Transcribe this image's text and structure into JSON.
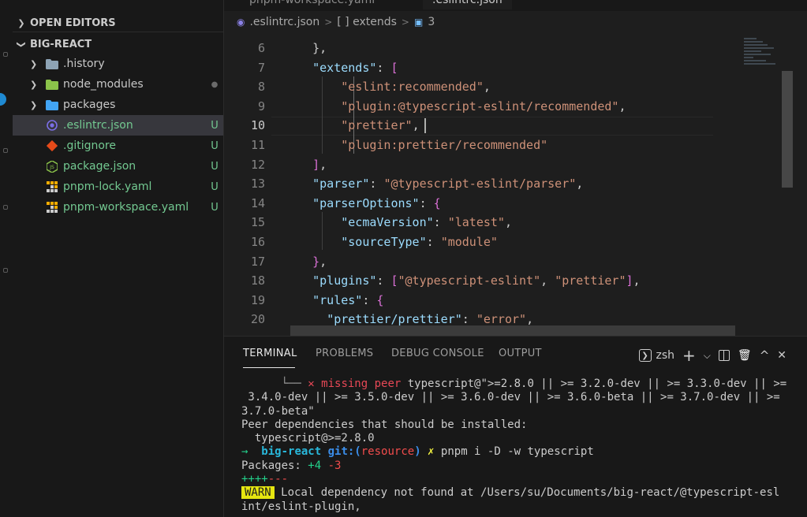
{
  "explorer": {
    "open_editors_label": "OPEN EDITORS",
    "project_label": "BIG-REACT",
    "items": [
      {
        "name": ".history",
        "kind": "folder",
        "icon": "folder-icon",
        "color": "#8da3b5"
      },
      {
        "name": "node_modules",
        "kind": "folder",
        "icon": "node-folder-icon",
        "color": "#8bc34a",
        "dot": "●"
      },
      {
        "name": "packages",
        "kind": "folder",
        "icon": "packages-folder-icon",
        "color": "#42a5f5"
      },
      {
        "name": ".eslintrc.json",
        "kind": "file",
        "icon": "eslint-icon",
        "color": "#7b6fe6",
        "status": "U",
        "selected": true
      },
      {
        "name": ".gitignore",
        "kind": "file",
        "icon": "git-icon",
        "color": "#e64a19",
        "status": "U"
      },
      {
        "name": "package.json",
        "kind": "file",
        "icon": "nodejs-icon",
        "color": "#8bc34a",
        "status": "U"
      },
      {
        "name": "pnpm-lock.yaml",
        "kind": "file",
        "icon": "pnpm-icon",
        "color": "#f9a825",
        "status": "U"
      },
      {
        "name": "pnpm-workspace.yaml",
        "kind": "file",
        "icon": "pnpm-icon",
        "color": "#f9a825",
        "status": "U"
      }
    ]
  },
  "tabs": [
    "pnpm-workspace.yaml",
    ".eslintrc.json"
  ],
  "breadcrumb": {
    "file": ".eslintrc.json",
    "sep": ">",
    "node": "[ ] extends",
    "count": "3"
  },
  "editor": {
    "current_line": 10,
    "lines": [
      {
        "n": "6",
        "tokens": [
          [
            "pn",
            "    },"
          ]
        ]
      },
      {
        "n": "7",
        "tokens": [
          [
            "pn",
            "    "
          ],
          [
            "k",
            "\"extends\""
          ],
          [
            "pn",
            ": "
          ],
          [
            "p",
            "["
          ]
        ]
      },
      {
        "n": "8",
        "tokens": [
          [
            "pn",
            "        "
          ],
          [
            "s",
            "\"eslint:recommended\""
          ],
          [
            "pn",
            ","
          ]
        ]
      },
      {
        "n": "9",
        "tokens": [
          [
            "pn",
            "        "
          ],
          [
            "s",
            "\"plugin:@typescript-eslint/recommended\""
          ],
          [
            "pn",
            ","
          ]
        ]
      },
      {
        "n": "10",
        "tokens": [
          [
            "pn",
            "        "
          ],
          [
            "s",
            "\"prettier\""
          ],
          [
            "pn",
            ","
          ]
        ]
      },
      {
        "n": "11",
        "tokens": [
          [
            "pn",
            "        "
          ],
          [
            "s",
            "\"plugin:prettier/recommended\""
          ]
        ]
      },
      {
        "n": "12",
        "tokens": [
          [
            "pn",
            "    "
          ],
          [
            "p",
            "]"
          ],
          [
            "pn",
            ","
          ]
        ]
      },
      {
        "n": "13",
        "tokens": [
          [
            "pn",
            "    "
          ],
          [
            "k",
            "\"parser\""
          ],
          [
            "pn",
            ": "
          ],
          [
            "s",
            "\"@typescript-eslint/parser\""
          ],
          [
            "pn",
            ","
          ]
        ]
      },
      {
        "n": "14",
        "tokens": [
          [
            "pn",
            "    "
          ],
          [
            "k",
            "\"parserOptions\""
          ],
          [
            "pn",
            ": "
          ],
          [
            "p",
            "{"
          ]
        ]
      },
      {
        "n": "15",
        "tokens": [
          [
            "pn",
            "        "
          ],
          [
            "k",
            "\"ecmaVersion\""
          ],
          [
            "pn",
            ": "
          ],
          [
            "s",
            "\"latest\""
          ],
          [
            "pn",
            ","
          ]
        ]
      },
      {
        "n": "16",
        "tokens": [
          [
            "pn",
            "        "
          ],
          [
            "k",
            "\"sourceType\""
          ],
          [
            "pn",
            ": "
          ],
          [
            "s",
            "\"module\""
          ]
        ]
      },
      {
        "n": "17",
        "tokens": [
          [
            "pn",
            "    "
          ],
          [
            "p",
            "}"
          ],
          [
            "pn",
            ","
          ]
        ]
      },
      {
        "n": "18",
        "tokens": [
          [
            "pn",
            "    "
          ],
          [
            "k",
            "\"plugins\""
          ],
          [
            "pn",
            ": "
          ],
          [
            "p",
            "["
          ],
          [
            "s",
            "\"@typescript-eslint\""
          ],
          [
            "pn",
            ", "
          ],
          [
            "s",
            "\"prettier\""
          ],
          [
            "p",
            "]"
          ],
          [
            "pn",
            ","
          ]
        ]
      },
      {
        "n": "19",
        "tokens": [
          [
            "pn",
            "    "
          ],
          [
            "k",
            "\"rules\""
          ],
          [
            "pn",
            ": "
          ],
          [
            "p",
            "{"
          ]
        ]
      },
      {
        "n": "20",
        "tokens": [
          [
            "pn",
            "      "
          ],
          [
            "k",
            "\"prettier/prettier\""
          ],
          [
            "pn",
            ": "
          ],
          [
            "s",
            "\"error\""
          ],
          [
            "pn",
            ","
          ]
        ]
      }
    ]
  },
  "panel": {
    "tabs": [
      "TERMINAL",
      "PROBLEMS",
      "DEBUG CONSOLE",
      "OUTPUT"
    ],
    "active_tab": "TERMINAL",
    "shell": "zsh",
    "actions": {
      "add": "+",
      "dropdown": "⌵",
      "trash": "🗑",
      "maximize": "^",
      "close": "✕"
    }
  },
  "terminal": {
    "lines": [
      [
        [
          "dim",
          "      └── "
        ],
        [
          "red",
          "✕ missing peer "
        ],
        [
          "pn",
          "typescript@\">=2.8.0 || >= 3.2.0-dev || >= 3.3.0-dev || >="
        ]
      ],
      [
        [
          "pn",
          " 3.4.0-dev || >= 3.5.0-dev || >= 3.6.0-dev || >= 3.6.0-beta || >= 3.7.0-dev || >="
        ]
      ],
      [
        [
          "pn",
          "3.7.0-beta\""
        ]
      ],
      [
        [
          "pn",
          "Peer dependencies that should be installed:"
        ]
      ],
      [
        [
          "pn",
          "  typescript@>=2.8.0"
        ]
      ],
      [
        [
          "green",
          "→  "
        ],
        [
          "cyan",
          "big-react "
        ],
        [
          "blue",
          "git:("
        ],
        [
          "redb",
          "resource"
        ],
        [
          "blue",
          ") "
        ],
        [
          "yel",
          "✗ "
        ],
        [
          "pn",
          "pnpm i -D -w typescript"
        ]
      ],
      [
        [
          "pn",
          "Packages: "
        ],
        [
          "green",
          "+4 "
        ],
        [
          "redb",
          "-3"
        ]
      ],
      [
        [
          "green",
          "++++"
        ],
        [
          "redb",
          "---"
        ]
      ],
      [
        [
          "warn",
          "WARN"
        ],
        [
          "pn",
          " Local dependency not found at /Users/su/Documents/big-react/@typescript-esl"
        ]
      ],
      [
        [
          "pn",
          "int/eslint-plugin,"
        ]
      ]
    ]
  },
  "colors": {
    "accent": "#1f8ad2",
    "untracked": "#73c991",
    "json_key": "#9cdcfe",
    "json_string": "#ce9178",
    "bracket": "#da70d6"
  }
}
